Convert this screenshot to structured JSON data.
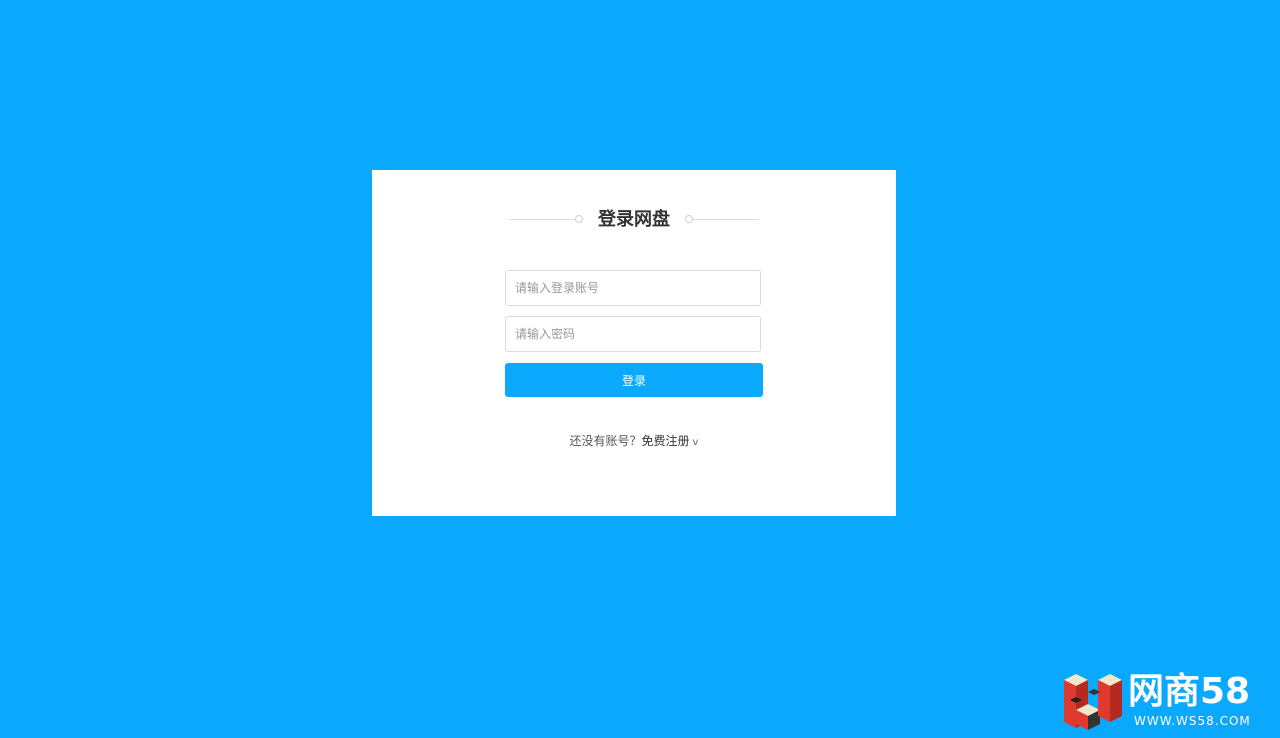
{
  "login": {
    "title": "登录网盘",
    "account_placeholder": "请输入登录账号",
    "password_placeholder": "请输入密码",
    "submit_label": "登录",
    "register_prompt": "还没有账号？",
    "register_link": "免费注册",
    "register_chevron": "v"
  },
  "watermark": {
    "name": "网商58",
    "url": "WWW.WS58.COM"
  },
  "colors": {
    "background": "#0aa9fd",
    "card": "#ffffff",
    "button": "#0aa9fd"
  }
}
